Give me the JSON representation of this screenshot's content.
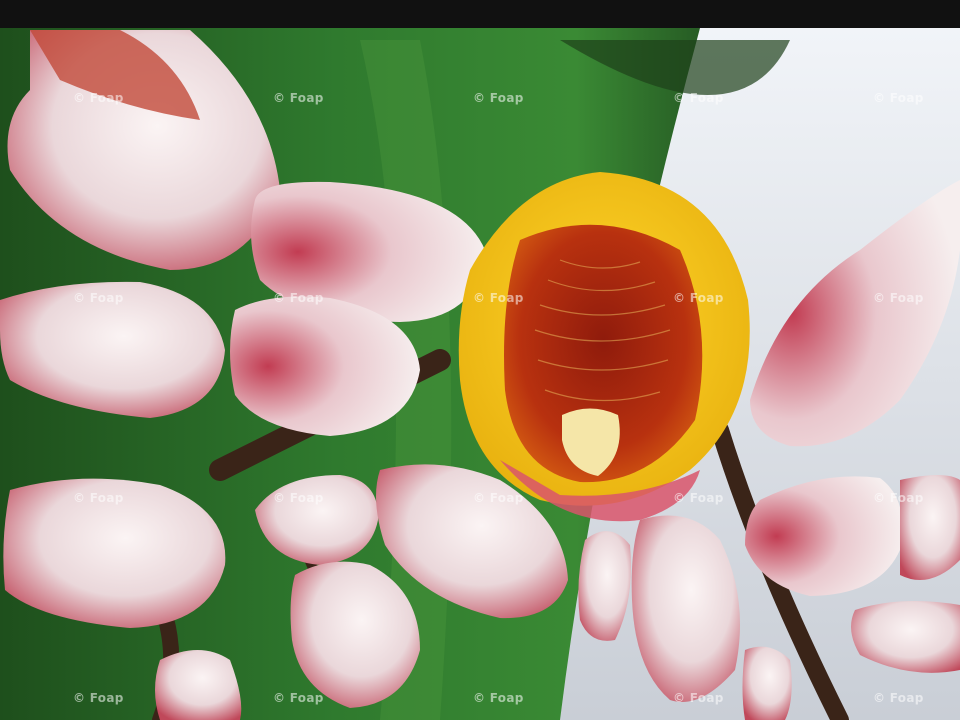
{
  "photo": {
    "subject": "Shell ginger (Alpinia zerumbet) flower cluster",
    "colors": {
      "leaf": "#2f7a2e",
      "bud_white": "#f2e6e6",
      "bud_pink": "#c94a5c",
      "lip_yellow": "#f3c316",
      "lip_red": "#a8220f",
      "background_right": "#e6ecf3"
    }
  },
  "watermark": {
    "text": "© Foap"
  }
}
